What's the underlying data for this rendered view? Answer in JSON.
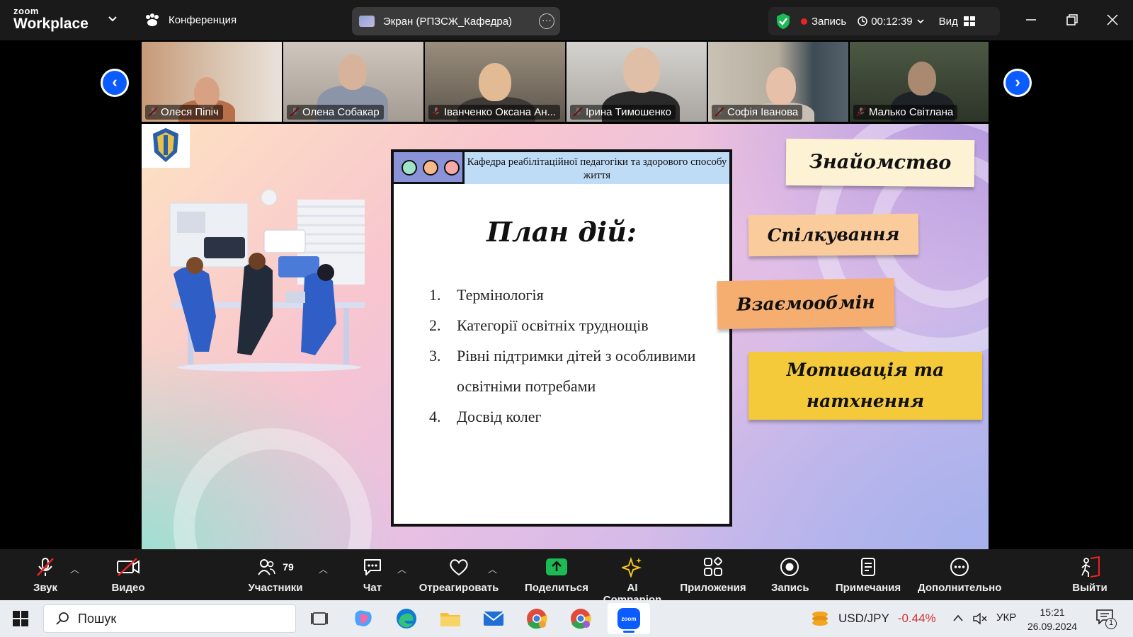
{
  "topbar": {
    "logo_top": "zoom",
    "logo_bottom": "Workplace",
    "meeting_label": "Конференция",
    "screen_label": "Экран (РПЗСЖ_Кафедра)",
    "record_label": "Запись",
    "timer": "00:12:39",
    "view_label": "Вид"
  },
  "participants": [
    {
      "name": "Олеся Піпіч",
      "muted": true
    },
    {
      "name": "Олена Собакар",
      "muted": true
    },
    {
      "name": "Іванченко Оксана Ан...",
      "muted": true
    },
    {
      "name": "Ірина Тимошенко",
      "muted": true
    },
    {
      "name": "Софія Іванова",
      "muted": true
    },
    {
      "name": "Малько Світлана",
      "muted": true
    }
  ],
  "slide": {
    "header": "Кафедра реабілітаційної педагогіки та здорового способу життя",
    "title": "План дій:",
    "items": [
      {
        "num": "1.",
        "text": "Термінологія"
      },
      {
        "num": "2.",
        "text": "Категорії освітніх труднощів"
      },
      {
        "num": "3.",
        "text": "Рівні підтримки дітей з особливими освітніми потребами"
      },
      {
        "num": "4.",
        "text": "Досвід колег"
      }
    ],
    "notes": [
      "Знайомство",
      "Спілкування",
      "Взаємообмін",
      "Мотивація та натхнення"
    ]
  },
  "toolbar": {
    "audio": "Звук",
    "video": "Видео",
    "participants": "Участники",
    "participants_count": "79",
    "chat": "Чат",
    "react": "Отреагировать",
    "share": "Поделиться",
    "ai": "AI Companion",
    "apps": "Приложения",
    "record": "Запись",
    "notes": "Примечания",
    "more": "Дополнительно",
    "leave": "Выйти"
  },
  "taskbar": {
    "search_placeholder": "Пошук",
    "ticker": "USD/JPY",
    "ticker_change": "-0.44%",
    "lang": "УКР",
    "time": "15:21",
    "date": "26.09.2024",
    "notif_count": "1"
  },
  "colors": {
    "accent": "#0b5cff",
    "record": "#e22222",
    "share": "#1db954",
    "ticker_down": "#d13438"
  }
}
